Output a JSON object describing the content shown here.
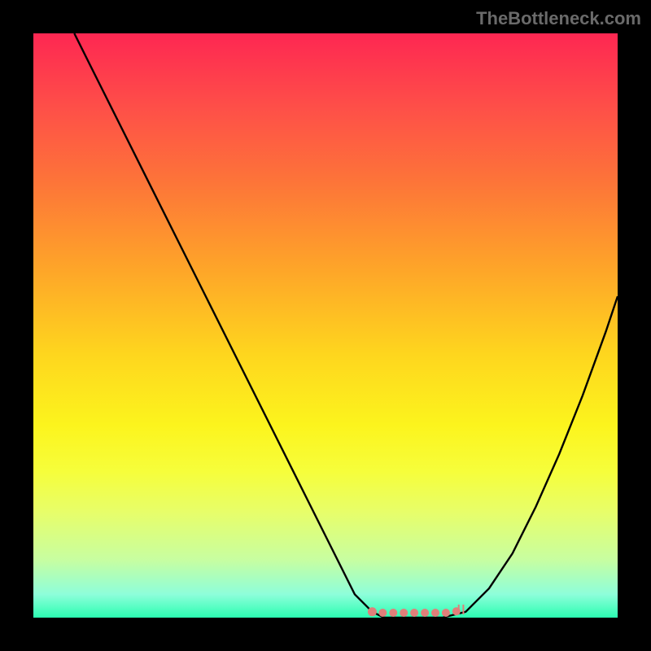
{
  "watermark": "TheBottleneck.com",
  "chart_data": {
    "type": "line",
    "title": "",
    "xlabel": "",
    "ylabel": "",
    "xlim": [
      0,
      100
    ],
    "ylim": [
      0,
      100
    ],
    "series": [
      {
        "name": "curve",
        "x": [
          7,
          10,
          15,
          20,
          25,
          30,
          35,
          40,
          45,
          50,
          55,
          58,
          60,
          62,
          66,
          70,
          74,
          78,
          82,
          86,
          90,
          94,
          98,
          100
        ],
        "y": [
          100,
          94,
          84,
          74,
          64,
          54,
          44,
          34,
          24,
          14,
          4,
          1,
          0,
          0,
          0,
          0,
          1,
          5,
          11,
          19,
          28,
          38,
          49,
          55
        ]
      }
    ],
    "flat_region": {
      "x_start": 58,
      "x_end": 74,
      "y": 0
    },
    "marker_color": "#e07f7a",
    "curve_color": "#000000"
  }
}
